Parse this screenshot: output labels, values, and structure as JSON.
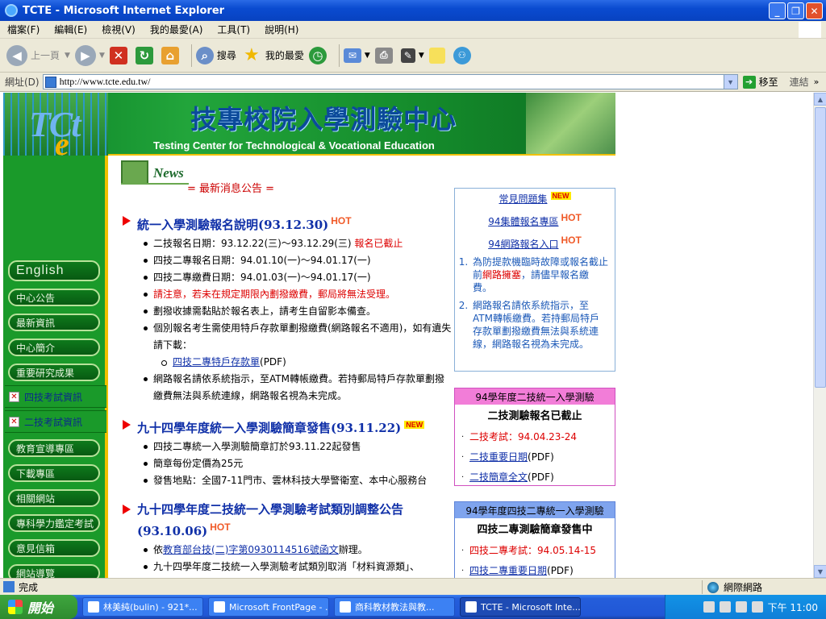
{
  "window": {
    "title": "TCTE - Microsoft Internet Explorer"
  },
  "menu": [
    "檔案(F)",
    "編輯(E)",
    "檢視(V)",
    "我的最愛(A)",
    "工具(T)",
    "說明(H)"
  ],
  "toolbar": {
    "back": "上一頁",
    "search": "搜尋",
    "favorites": "我的最愛"
  },
  "address": {
    "label": "網址(D)",
    "url": "http://www.tcte.edu.tw/",
    "go": "移至",
    "links": "連結"
  },
  "banner": {
    "title_cn": "技專校院入學測驗中心",
    "title_en": "Testing Center for Technological & Vocational Education",
    "logo_t": "TCt",
    "logo_e": "e"
  },
  "sidebar": {
    "english": "English",
    "items": [
      "中心公告",
      "最新資訊",
      "中心簡介",
      "重要研究成果"
    ],
    "img_items": [
      "四技考試資訊",
      "二技考試資訊"
    ],
    "items2": [
      "教育宣導專區",
      "下載專區",
      "相關網站",
      "專科學力鑑定考試",
      "意見信箱",
      "網站導覽"
    ]
  },
  "news": {
    "logo": "News",
    "latest": "= 最新消息公告 ="
  },
  "sections": [
    {
      "title": "統一入學測驗報名說明(93.12.30)",
      "badge": "HOT",
      "items": [
        {
          "a": "二技報名日期：93.12.22(三)～93.12.29(三) ",
          "b": "報名已截止"
        },
        {
          "a": "四技二專報名日期：94.01.10(一)～94.01.17(一)"
        },
        {
          "a": "四技二專繳費日期：94.01.03(一)～94.01.17(一)"
        },
        {
          "a": "請注意，若未在規定期限內劃撥繳費，郵局將無法受理。"
        },
        {
          "a": "劃撥收據需黏貼於報名表上，請考生自留影本備查。"
        },
        {
          "a": "個別報名考生需使用特戶存款單劃撥繳費(網路報名不適用)，如有遺失請下載："
        },
        {
          "link": "四技二專特戶存款單",
          "suffix": "(PDF)"
        },
        {
          "a": "網路報名請依系統指示，至ATM轉帳繳費。若持郵局特戶存款單劃撥繳費無法與系統連線，網路報名視為未完成。"
        }
      ]
    },
    {
      "title": "九十四學年度統一入學測驗簡章發售(93.11.22)",
      "badge": "NEW",
      "items": [
        {
          "a": "四技二專統一入學測驗簡章訂於93.11.22起發售"
        },
        {
          "a": "簡章每份定價為25元"
        },
        {
          "a": "發售地點：全國7-11門市、雲林科技大學警衛室、本中心服務台"
        }
      ]
    },
    {
      "title": "九十四學年度二技統一入學測驗考試類別調整公告",
      "date": "(93.10.06)",
      "badge": "HOT",
      "items": [
        {
          "pre": "依",
          "link": "教育部台技(二)字第0930114516號函文",
          "suffix": "辦理。"
        },
        {
          "a": "九十四學年度二技統一入學測驗考試類別取消「材料資源類」、"
        }
      ]
    }
  ],
  "faq": {
    "title": "常見問題集",
    "badge_new": "NEW",
    "group_link": "94集體報名專區",
    "online_link": "94網路報名入口",
    "badge_hot": "HOT",
    "notes": [
      {
        "a": "為防提款機臨時故障或報名截止前",
        "b": "網路擁塞",
        "c": "，請儘早報名繳費。"
      },
      {
        "a": "網路報名請依系統指示，至ATM轉帳繳費。若持郵局特戶存款單劃撥繳費無法與系統連線，網路報名視為未完成。"
      }
    ]
  },
  "box1": {
    "header": "94學年度二技統一入學測驗",
    "subtitle": "二技測驗報名已截止",
    "items": [
      {
        "text": "二技考試：94.04.23-24",
        "style": "red"
      },
      {
        "link": "二技重要日期",
        "suffix": "(PDF)"
      },
      {
        "link": "二技簡章全文",
        "suffix": "(PDF)"
      }
    ]
  },
  "box2": {
    "header": "94學年度四技二專統一入學測驗",
    "subtitle": "四技二專測驗簡章發售中",
    "items": [
      {
        "text": "四技二專考試：94.05.14-15",
        "style": "red"
      },
      {
        "link": "四技二專重要日期",
        "suffix": "(PDF)"
      }
    ]
  },
  "status": {
    "text": "完成",
    "zone": "網際網路"
  },
  "taskbar": {
    "start": "開始",
    "tasks": [
      "林美純(bulin) - 921*...",
      "Microsoft FrontPage - ...",
      "商科教材教法與教...",
      "TCTE - Microsoft Inte..."
    ],
    "clock": "下午 11:00"
  },
  "colors": {
    "title_blue": "#0a4bd0",
    "banner_green": "#1a9a2a",
    "link_blue": "#1030a8",
    "hot_red": "#f05a28"
  }
}
